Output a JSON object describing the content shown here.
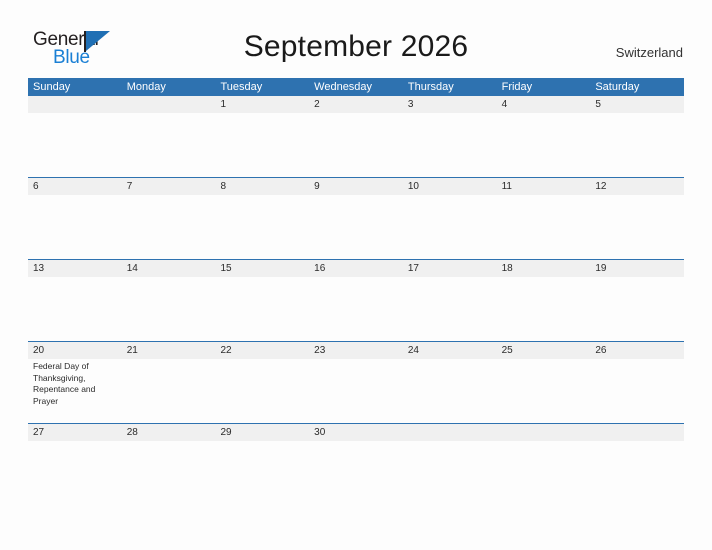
{
  "brand": {
    "name_part1": "General",
    "name_part2": "Blue",
    "flag_icon": "blue-triangle-flag-icon"
  },
  "header": {
    "title": "September 2026",
    "country": "Switzerland"
  },
  "calendar": {
    "colors": {
      "header_blue": "#2e72b0",
      "number_strip": "#f0f0f0",
      "page_background": "#fdfdfd",
      "brand_blue": "#1a7fd4",
      "text": "#2b2b2b"
    },
    "day_headers": [
      "Sunday",
      "Monday",
      "Tuesday",
      "Wednesday",
      "Thursday",
      "Friday",
      "Saturday"
    ],
    "weeks": [
      {
        "days": [
          {
            "number": "",
            "events": []
          },
          {
            "number": "",
            "events": []
          },
          {
            "number": "1",
            "events": []
          },
          {
            "number": "2",
            "events": []
          },
          {
            "number": "3",
            "events": []
          },
          {
            "number": "4",
            "events": []
          },
          {
            "number": "5",
            "events": []
          }
        ]
      },
      {
        "days": [
          {
            "number": "6",
            "events": []
          },
          {
            "number": "7",
            "events": []
          },
          {
            "number": "8",
            "events": []
          },
          {
            "number": "9",
            "events": []
          },
          {
            "number": "10",
            "events": []
          },
          {
            "number": "11",
            "events": []
          },
          {
            "number": "12",
            "events": []
          }
        ]
      },
      {
        "days": [
          {
            "number": "13",
            "events": []
          },
          {
            "number": "14",
            "events": []
          },
          {
            "number": "15",
            "events": []
          },
          {
            "number": "16",
            "events": []
          },
          {
            "number": "17",
            "events": []
          },
          {
            "number": "18",
            "events": []
          },
          {
            "number": "19",
            "events": []
          }
        ]
      },
      {
        "days": [
          {
            "number": "20",
            "events": [
              "Federal Day of Thanksgiving, Repentance and Prayer"
            ]
          },
          {
            "number": "21",
            "events": []
          },
          {
            "number": "22",
            "events": []
          },
          {
            "number": "23",
            "events": []
          },
          {
            "number": "24",
            "events": []
          },
          {
            "number": "25",
            "events": []
          },
          {
            "number": "26",
            "events": []
          }
        ]
      },
      {
        "days": [
          {
            "number": "27",
            "events": []
          },
          {
            "number": "28",
            "events": []
          },
          {
            "number": "29",
            "events": []
          },
          {
            "number": "30",
            "events": []
          },
          {
            "number": "",
            "events": []
          },
          {
            "number": "",
            "events": []
          },
          {
            "number": "",
            "events": []
          }
        ]
      }
    ]
  }
}
